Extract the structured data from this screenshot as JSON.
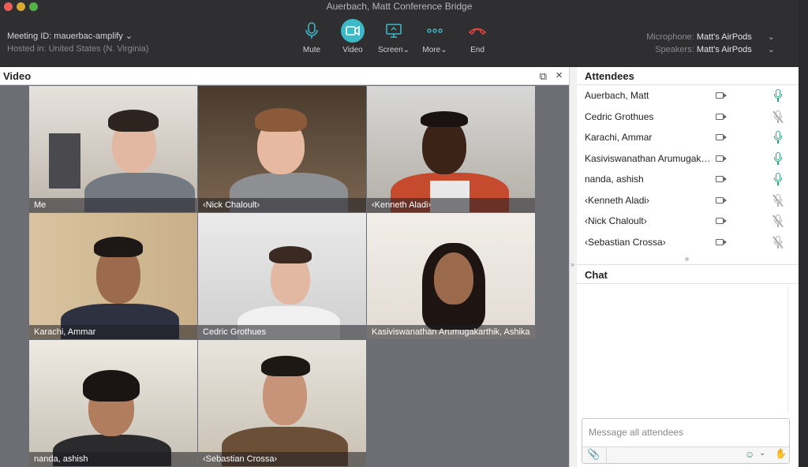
{
  "window": {
    "title": "Auerbach, Matt Conference Bridge"
  },
  "meeting": {
    "id_label": "Meeting ID: mauerbac-amplify",
    "hosted": "Hosted in: United States (N. Virginia)"
  },
  "toolbar": {
    "mute": "Mute",
    "video": "Video",
    "screen": "Screen",
    "more": "More",
    "end": "End"
  },
  "audio": {
    "mic_key": "Microphone:",
    "mic_val": "Matt's AirPods",
    "spk_key": "Speakers:",
    "spk_val": "Matt's AirPods"
  },
  "video_panel": {
    "title": "Video"
  },
  "tiles": [
    {
      "name": "Me"
    },
    {
      "name": "‹Nick Chaloult›"
    },
    {
      "name": "‹Kenneth Aladi›"
    },
    {
      "name": "Karachi, Ammar"
    },
    {
      "name": "Cedric Grothues"
    },
    {
      "name": "Kasiviswanathan Arumugakarthik, Ashika"
    },
    {
      "name": "nanda, ashish"
    },
    {
      "name": "‹Sebastian Crossa›"
    }
  ],
  "attendees": {
    "title": "Attendees",
    "list": [
      {
        "name": "Auerbach, Matt",
        "mic": "on"
      },
      {
        "name": "Cedric Grothues",
        "mic": "off"
      },
      {
        "name": "Karachi, Ammar",
        "mic": "on"
      },
      {
        "name": "Kasiviswanathan Arumugakarthik, Ashika",
        "mic": "on"
      },
      {
        "name": "nanda, ashish",
        "mic": "on"
      },
      {
        "name": "‹Kenneth Aladi›",
        "mic": "off"
      },
      {
        "name": "‹Nick Chaloult›",
        "mic": "off"
      },
      {
        "name": "‹Sebastian Crossa›",
        "mic": "off"
      }
    ]
  },
  "chat": {
    "title": "Chat",
    "placeholder": "Message all attendees"
  },
  "colors": {
    "accent": "#3db8c6",
    "end": "#e0453f",
    "mic_on": "#2aa879",
    "active_tile": "#e6b84a"
  }
}
